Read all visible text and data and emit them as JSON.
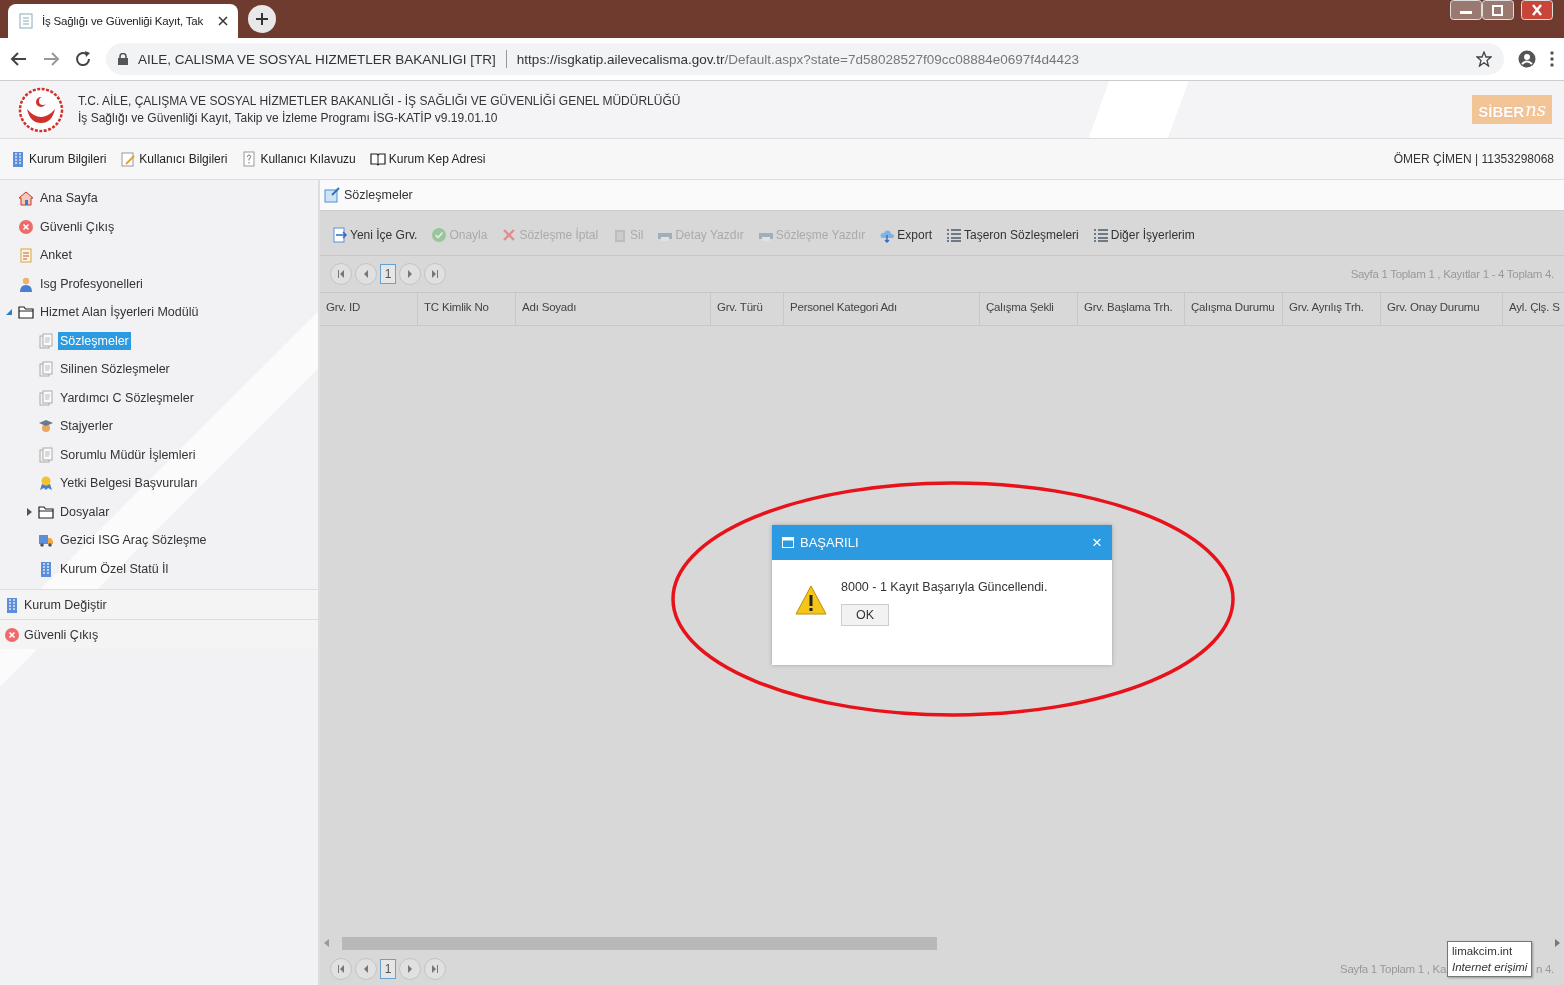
{
  "browser": {
    "tab_title": "İş Sağlığı ve Güvenliği Kayıt, Tak",
    "site_label": "AILE, CALISMA VE SOSYAL HIZMETLER BAKANLIGI [TR]",
    "url_host": "https://isgkatip.ailevecalisma.gov.tr",
    "url_path": "/Default.aspx?state=7d58028527f09cc08884e0697f4d4423"
  },
  "header": {
    "title": "T.C. AİLE, ÇALIŞMA VE SOSYAL HİZMETLER BAKANLIĞI - İŞ SAĞLIĞI VE GÜVENLİĞİ GENEL MÜDÜRLÜĞÜ",
    "subtitle": "İş Sağlığı ve Güvenliği Kayıt, Takip ve İzleme Programı İSG-KATİP v9.19.01.10",
    "logo_text": "SİBER",
    "logo_script": "ns"
  },
  "menu": {
    "items": [
      {
        "label": "Kurum Bilgileri",
        "kind": "building"
      },
      {
        "label": "Kullanıcı Bilgileri",
        "kind": "edit"
      },
      {
        "label": "Kullanıcı Kılavuzu",
        "kind": "help"
      },
      {
        "label": "Kurum Kep Adresi",
        "kind": "book"
      }
    ],
    "user": "ÖMER ÇİMEN | 11353298068"
  },
  "sidebar": {
    "tree": [
      {
        "label": "Ana Sayfa",
        "kind": "home",
        "selected": false
      },
      {
        "label": "Güvenli Çıkış",
        "kind": "exit",
        "selected": false
      },
      {
        "label": "Anket",
        "kind": "clipboard",
        "selected": false
      },
      {
        "label": "Isg Profesyonelleri",
        "kind": "person",
        "selected": false
      },
      {
        "label": "Hizmet Alan İşyerleri Modülü",
        "kind": "folder",
        "selected": false,
        "expanded": true,
        "children": [
          {
            "label": "Sözleşmeler",
            "kind": "document",
            "selected": true
          },
          {
            "label": "Silinen Sözleşmeler",
            "kind": "document",
            "selected": false
          },
          {
            "label": "Yardımcı C Sözleşmeler",
            "kind": "document",
            "selected": false
          },
          {
            "label": "Stajyerler",
            "kind": "student",
            "selected": false
          },
          {
            "label": "Sorumlu Müdür İşlemleri",
            "kind": "document",
            "selected": false
          },
          {
            "label": "Yetki Belgesi Başvuruları",
            "kind": "award",
            "selected": false
          },
          {
            "label": "Dosyalar",
            "kind": "folder",
            "selected": false,
            "expanded": false
          },
          {
            "label": "Gezici ISG Araç Sözleşme",
            "kind": "truck",
            "selected": false
          },
          {
            "label": "Kurum Özel Statü İl",
            "kind": "building",
            "selected": false
          }
        ]
      }
    ],
    "bottom": [
      {
        "label": "Kurum Değiştir",
        "kind": "building"
      },
      {
        "label": "Güvenli Çıkış",
        "kind": "exit"
      }
    ]
  },
  "panel": {
    "title": "Sözleşmeler",
    "toolbar": [
      {
        "label": "Yeni İçe Grv.",
        "kind": "add",
        "disabled": false
      },
      {
        "label": "Onayla",
        "kind": "check",
        "disabled": true
      },
      {
        "label": "Sözleşme İptal",
        "kind": "cancel",
        "disabled": true
      },
      {
        "label": "Sil",
        "kind": "trash",
        "disabled": true
      },
      {
        "label": "Detay Yazdır",
        "kind": "print",
        "disabled": true
      },
      {
        "label": "Sözleşme Yazdır",
        "kind": "print",
        "disabled": true
      },
      {
        "label": "Export",
        "kind": "cloud",
        "disabled": false
      },
      {
        "label": "Taşeron Sözleşmeleri",
        "kind": "list",
        "disabled": false
      },
      {
        "label": "Diğer İşyerlerim",
        "kind": "list",
        "disabled": false
      }
    ],
    "pager_top": {
      "page": "1",
      "info": "Sayfa 1 Toplam 1 , Kayıtlar 1 - 4 Toplam 4."
    },
    "columns": [
      "Grv. ID",
      "TC Kimlik No",
      "Adı Soyadı",
      "Grv. Türü",
      "Personel Kategori Adı",
      "Çalışma Şekli",
      "Grv. Başlama Trh.",
      "Çalışma Durumu",
      "Grv. Ayrılış Trh.",
      "Grv. Onay Durumu",
      "Ayl. Çlş. S"
    ],
    "pager_bottom": {
      "page": "1",
      "info_left": "Sayfa 1 Toplam 1 , Ka",
      "info_right": "n 4."
    }
  },
  "dialog": {
    "title": "BAŞARILI",
    "close": "×",
    "message": "8000 - 1 Kayıt Başarıyla Güncellendi.",
    "button": "OK"
  },
  "tooltip": {
    "line1": "limakcim.int",
    "line2": "Internet erişimi"
  }
}
